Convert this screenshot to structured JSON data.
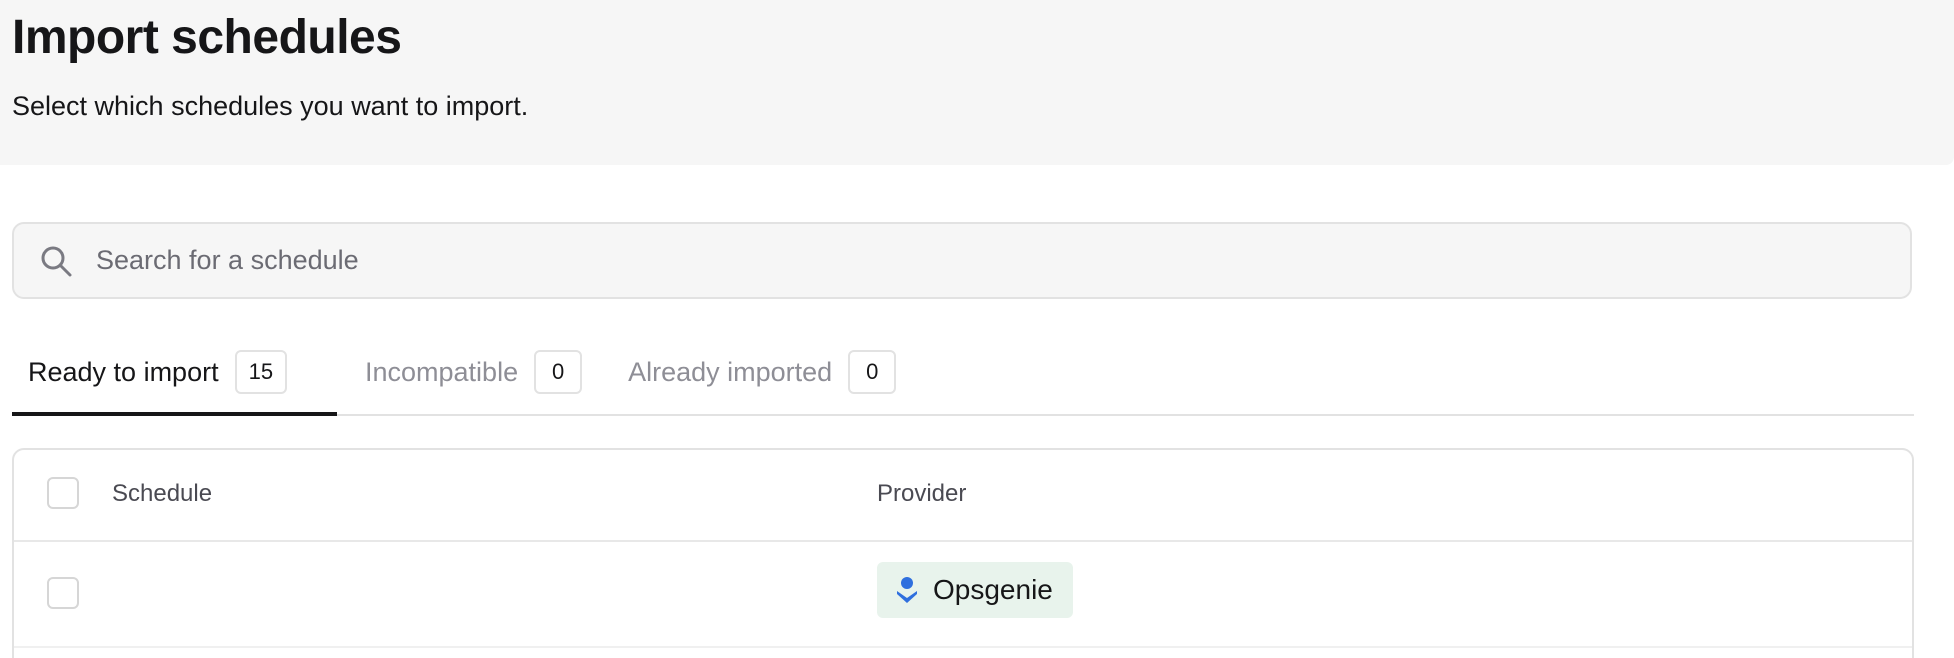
{
  "header": {
    "title": "Import schedules",
    "subtitle": "Select which schedules you want to import."
  },
  "search": {
    "placeholder": "Search for a schedule",
    "value": "",
    "icon": "search-icon"
  },
  "tabs": [
    {
      "label": "Ready to import",
      "count": "15",
      "active": true
    },
    {
      "label": "Incompatible",
      "count": "0",
      "active": false
    },
    {
      "label": "Already imported",
      "count": "0",
      "active": false
    }
  ],
  "table": {
    "columns": {
      "schedule": "Schedule",
      "provider": "Provider"
    },
    "rows": [
      {
        "schedule": "",
        "provider": "Opsgenie",
        "provider_icon": "opsgenie-icon",
        "checked": false
      }
    ]
  },
  "colors": {
    "header_bg": "#f6f6f6",
    "provider_badge_bg": "#e8f3ec",
    "opsgenie_blue": "#2f6fde",
    "active_tab_underline": "#161618"
  }
}
